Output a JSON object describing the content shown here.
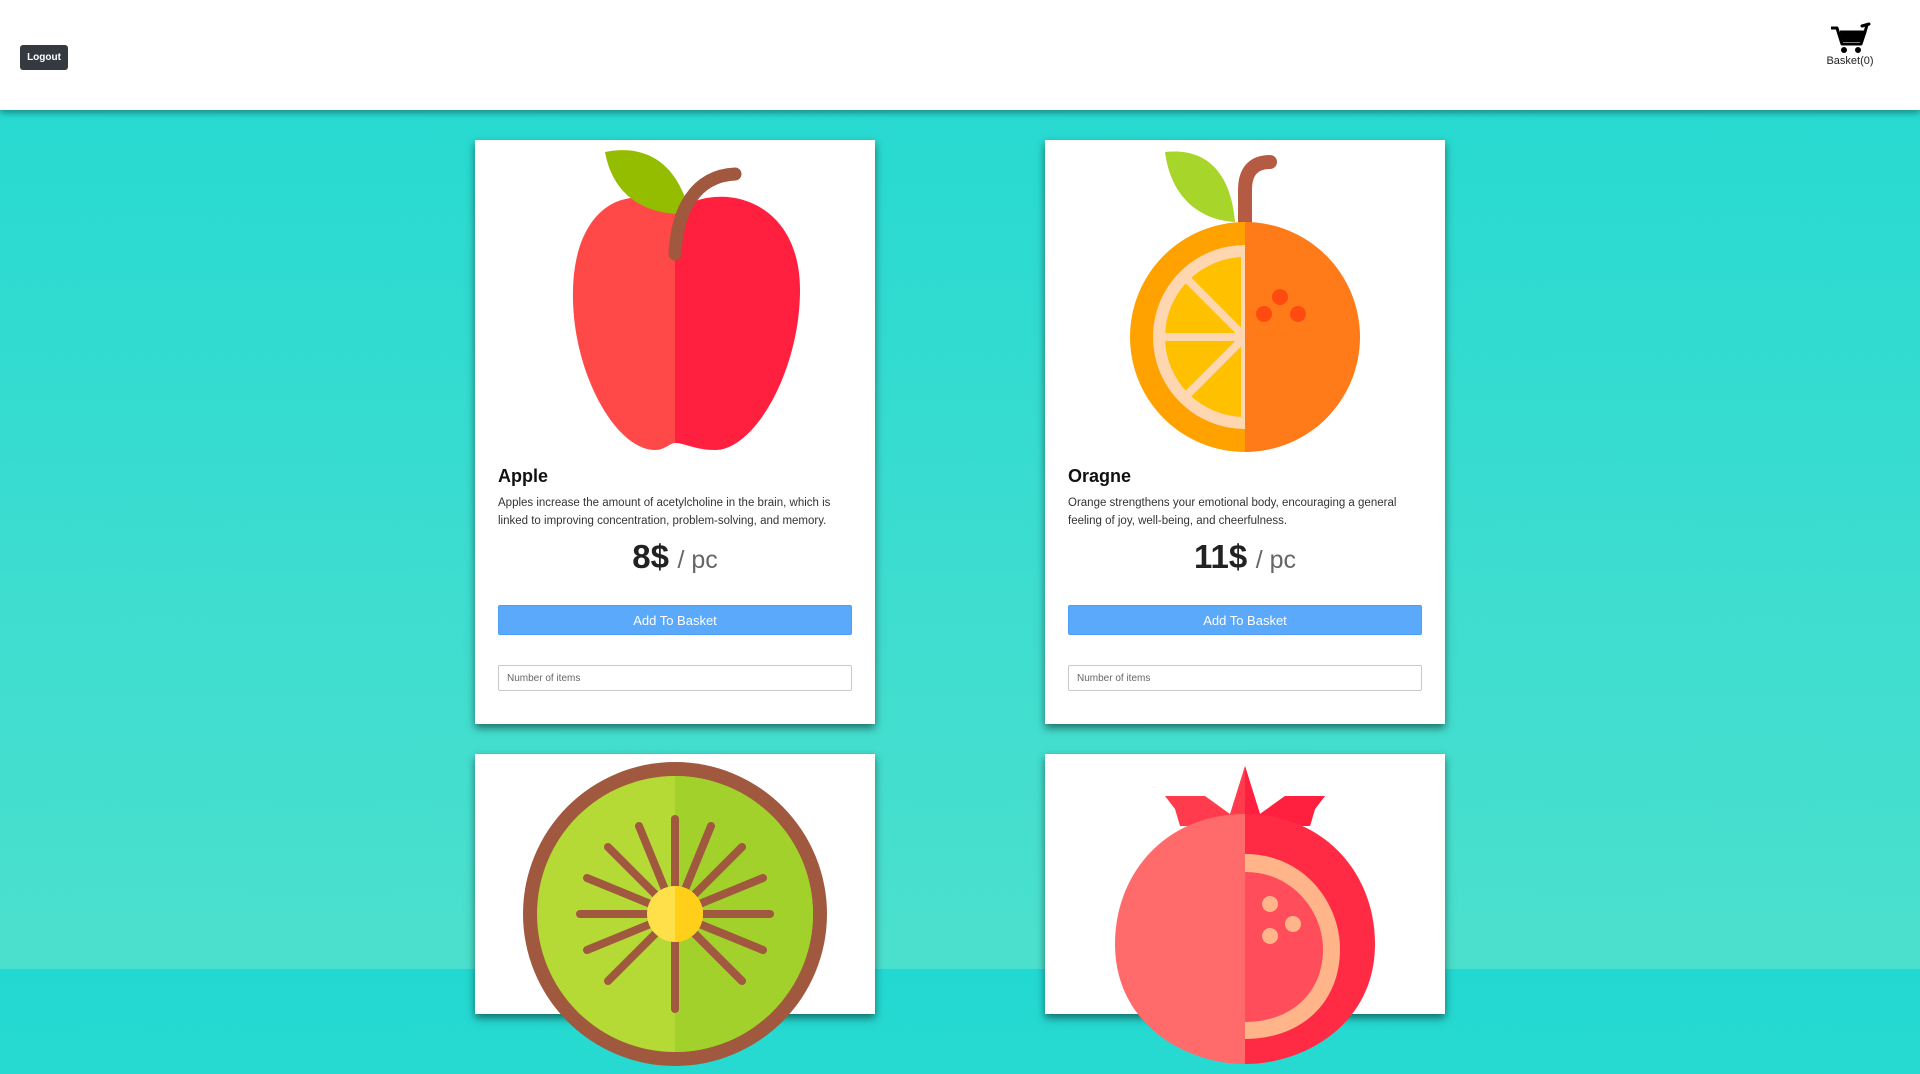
{
  "header": {
    "logout_label": "Logout",
    "basket_label": "Basket(0)",
    "basket_icon": "shopping-cart-icon"
  },
  "products": [
    {
      "name": "Apple",
      "description": "Apples increase the amount of acetylcholine in the brain, which is linked to improving concentration, problem-solving, and memory.",
      "price": "8$",
      "unit": "/ pc",
      "button_label": "Add To Basket",
      "input_placeholder": "Number of items",
      "icon": "apple-icon"
    },
    {
      "name": "Oragne",
      "description": "Orange strengthens your emotional body, encouraging a general feeling of joy, well-being, and cheerfulness.",
      "price": "11$",
      "unit": "/ pc",
      "button_label": "Add To Basket",
      "input_placeholder": "Number of items",
      "icon": "orange-icon"
    },
    {
      "icon": "kiwi-icon"
    },
    {
      "icon": "pomegranate-icon"
    }
  ],
  "colors": {
    "button": "#5aa9fb",
    "logout": "#343a40",
    "background_top": "#22d9d1",
    "background_bottom": "#4be0cd"
  }
}
